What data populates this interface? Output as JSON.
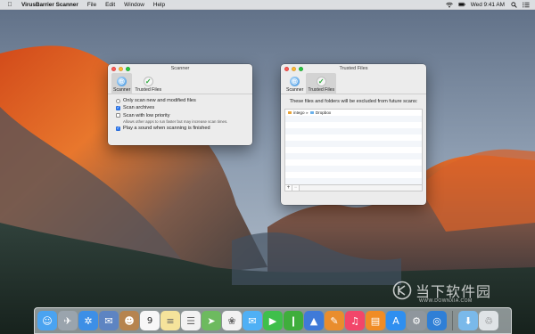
{
  "menubar": {
    "app_name": "VirusBarrier Scanner",
    "menus": [
      "File",
      "Edit",
      "Window",
      "Help"
    ],
    "clock": "Wed 9:41 AM"
  },
  "scanner_window": {
    "title": "Scanner",
    "tabs": [
      {
        "label": "Scanner",
        "icon": "scanner-icon",
        "selected": true
      },
      {
        "label": "Trusted Files",
        "icon": "checkmark-icon",
        "selected": false
      }
    ],
    "options": {
      "only_new": {
        "label": "Only scan new and modified files",
        "type": "radio",
        "checked": false
      },
      "archives": {
        "label": "Scan archives",
        "type": "checkbox",
        "checked": true
      },
      "low_priority": {
        "label": "Scan with low priority",
        "sub": "Allows other apps to run faster but may increase scan times.",
        "type": "checkbox",
        "checked": false
      },
      "play_sound": {
        "label": "Play a sound when scanning is finished",
        "type": "checkbox",
        "checked": true
      }
    }
  },
  "trusted_window": {
    "title": "Trusted Files",
    "tabs": [
      {
        "label": "Scanner",
        "icon": "scanner-icon",
        "selected": false
      },
      {
        "label": "Trusted Files",
        "icon": "checkmark-icon",
        "selected": true
      }
    ],
    "header": "These files and folders will be excluded from future scans:",
    "entries": [
      {
        "parts": [
          "intego",
          "Dropbox"
        ]
      }
    ],
    "add_label": "+",
    "remove_label": "−"
  },
  "dock": {
    "apps": [
      {
        "name": "Finder",
        "icon": "finder-icon",
        "color": "#4aa3f0"
      },
      {
        "name": "Launchpad",
        "icon": "rocket-icon",
        "color": "#9aa4ad"
      },
      {
        "name": "Safari",
        "icon": "compass-icon",
        "color": "#3d8fe6"
      },
      {
        "name": "Mail",
        "icon": "photo-stamp-icon",
        "color": "#5d84c2"
      },
      {
        "name": "Contacts",
        "icon": "contacts-icon",
        "color": "#b6844f"
      },
      {
        "name": "Calendar",
        "icon": "calendar-icon",
        "color": "#f7f7f7",
        "text": "9"
      },
      {
        "name": "Notes",
        "icon": "notes-icon",
        "color": "#f5e39b"
      },
      {
        "name": "Reminders",
        "icon": "reminders-icon",
        "color": "#f2f2f2"
      },
      {
        "name": "Maps",
        "icon": "maps-icon",
        "color": "#6dba5f"
      },
      {
        "name": "Photos",
        "icon": "photos-icon",
        "color": "#f2f2f2"
      },
      {
        "name": "Messages",
        "icon": "messages-icon",
        "color": "#4fb0f5"
      },
      {
        "name": "FaceTime",
        "icon": "facetime-icon",
        "color": "#3fbf4b"
      },
      {
        "name": "Numbers",
        "icon": "numbers-icon",
        "color": "#3fae3c"
      },
      {
        "name": "Keynote",
        "icon": "keynote-icon",
        "color": "#3f7ad8"
      },
      {
        "name": "Pages",
        "icon": "pages-icon",
        "color": "#e98d2d"
      },
      {
        "name": "iTunes",
        "icon": "music-icon",
        "color": "#f2466a"
      },
      {
        "name": "iBooks",
        "icon": "books-icon",
        "color": "#f08c25"
      },
      {
        "name": "App Store",
        "icon": "app-store-icon",
        "color": "#2f8ff0"
      },
      {
        "name": "System Preferences",
        "icon": "gear-icon",
        "color": "#8f969d"
      },
      {
        "name": "VirusBarrier Scanner",
        "icon": "scanner-icon",
        "color": "#2f7fd6"
      },
      {
        "name": "Downloads",
        "icon": "download-folder-icon",
        "color": "#7ab9ea"
      },
      {
        "name": "Trash",
        "icon": "trash-icon",
        "color": "#dfe3e6"
      }
    ]
  },
  "watermark": {
    "text": "当下软件园",
    "url": "WWW.DOWNXIA.COM"
  }
}
